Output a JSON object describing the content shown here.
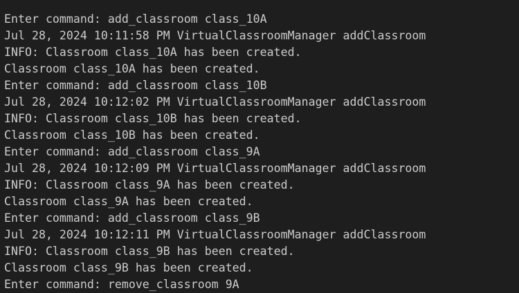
{
  "terminal": {
    "background": "#1e1e1e",
    "foreground": "#cccccc",
    "lines": [
      "Enter command: add_classroom class_10A",
      "Jul 28, 2024 10:11:58 PM VirtualClassroomManager addClassroom",
      "INFO: Classroom class_10A has been created.",
      "Classroom class_10A has been created.",
      "Enter command: add_classroom class_10B",
      "Jul 28, 2024 10:12:02 PM VirtualClassroomManager addClassroom",
      "INFO: Classroom class_10B has been created.",
      "Classroom class_10B has been created.",
      "Enter command: add_classroom class_9A",
      "Jul 28, 2024 10:12:09 PM VirtualClassroomManager addClassroom",
      "INFO: Classroom class_9A has been created.",
      "Classroom class_9A has been created.",
      "Enter command: add_classroom class_9B",
      "Jul 28, 2024 10:12:11 PM VirtualClassroomManager addClassroom",
      "INFO: Classroom class_9B has been created.",
      "Classroom class_9B has been created.",
      "Enter command: remove_classroom 9A"
    ]
  }
}
